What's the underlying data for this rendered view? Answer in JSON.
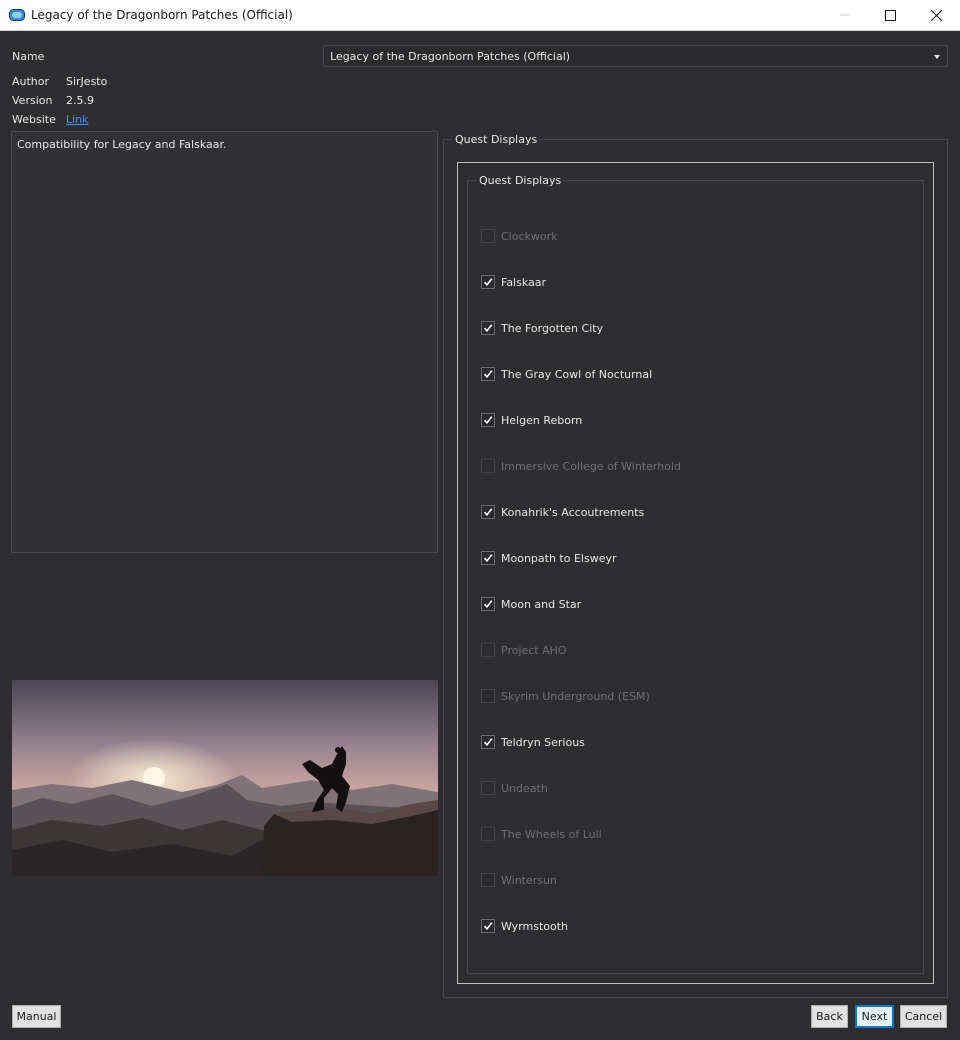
{
  "window": {
    "title": "Legacy of the Dragonborn Patches (Official)",
    "controls": {
      "minimize": "minimize-icon",
      "maximize": "maximize-icon",
      "close": "close-icon"
    }
  },
  "info": {
    "name_label": "Name",
    "name_value": "Legacy of the Dragonborn Patches (Official)",
    "author_label": "Author",
    "author_value": "SirJesto",
    "version_label": "Version",
    "version_value": "2.5.9",
    "website_label": "Website",
    "website_link": "Link"
  },
  "description": "Compatibility for Legacy and Falskaar.",
  "group": {
    "outer_title": "Quest Displays",
    "inner_title": "Quest Displays",
    "options": [
      {
        "label": "Clockwork",
        "checked": false,
        "enabled": false
      },
      {
        "label": "Falskaar",
        "checked": true,
        "enabled": true
      },
      {
        "label": "The Forgotten City",
        "checked": true,
        "enabled": true
      },
      {
        "label": "The Gray Cowl of Nocturnal",
        "checked": true,
        "enabled": true
      },
      {
        "label": "Helgen Reborn",
        "checked": true,
        "enabled": true
      },
      {
        "label": "Immersive College of Winterhold",
        "checked": false,
        "enabled": false
      },
      {
        "label": "Konahrik's Accoutrements",
        "checked": true,
        "enabled": true
      },
      {
        "label": "Moonpath to Elsweyr",
        "checked": true,
        "enabled": true
      },
      {
        "label": "Moon and Star",
        "checked": true,
        "enabled": true
      },
      {
        "label": "Project AHO",
        "checked": false,
        "enabled": false
      },
      {
        "label": "Skyrim Underground (ESM)",
        "checked": false,
        "enabled": false
      },
      {
        "label": "Teldryn Serious",
        "checked": true,
        "enabled": true
      },
      {
        "label": "Undeath",
        "checked": false,
        "enabled": false
      },
      {
        "label": "The Wheels of Lull",
        "checked": false,
        "enabled": false
      },
      {
        "label": "Wintersun",
        "checked": false,
        "enabled": false
      },
      {
        "label": "Wyrmstooth",
        "checked": true,
        "enabled": true
      }
    ]
  },
  "buttons": {
    "manual": "Manual",
    "back": "Back",
    "next": "Next",
    "cancel": "Cancel"
  },
  "colors": {
    "background": "#2e2e31",
    "link": "#3d95ff",
    "default_button_border": "#0078d7"
  }
}
